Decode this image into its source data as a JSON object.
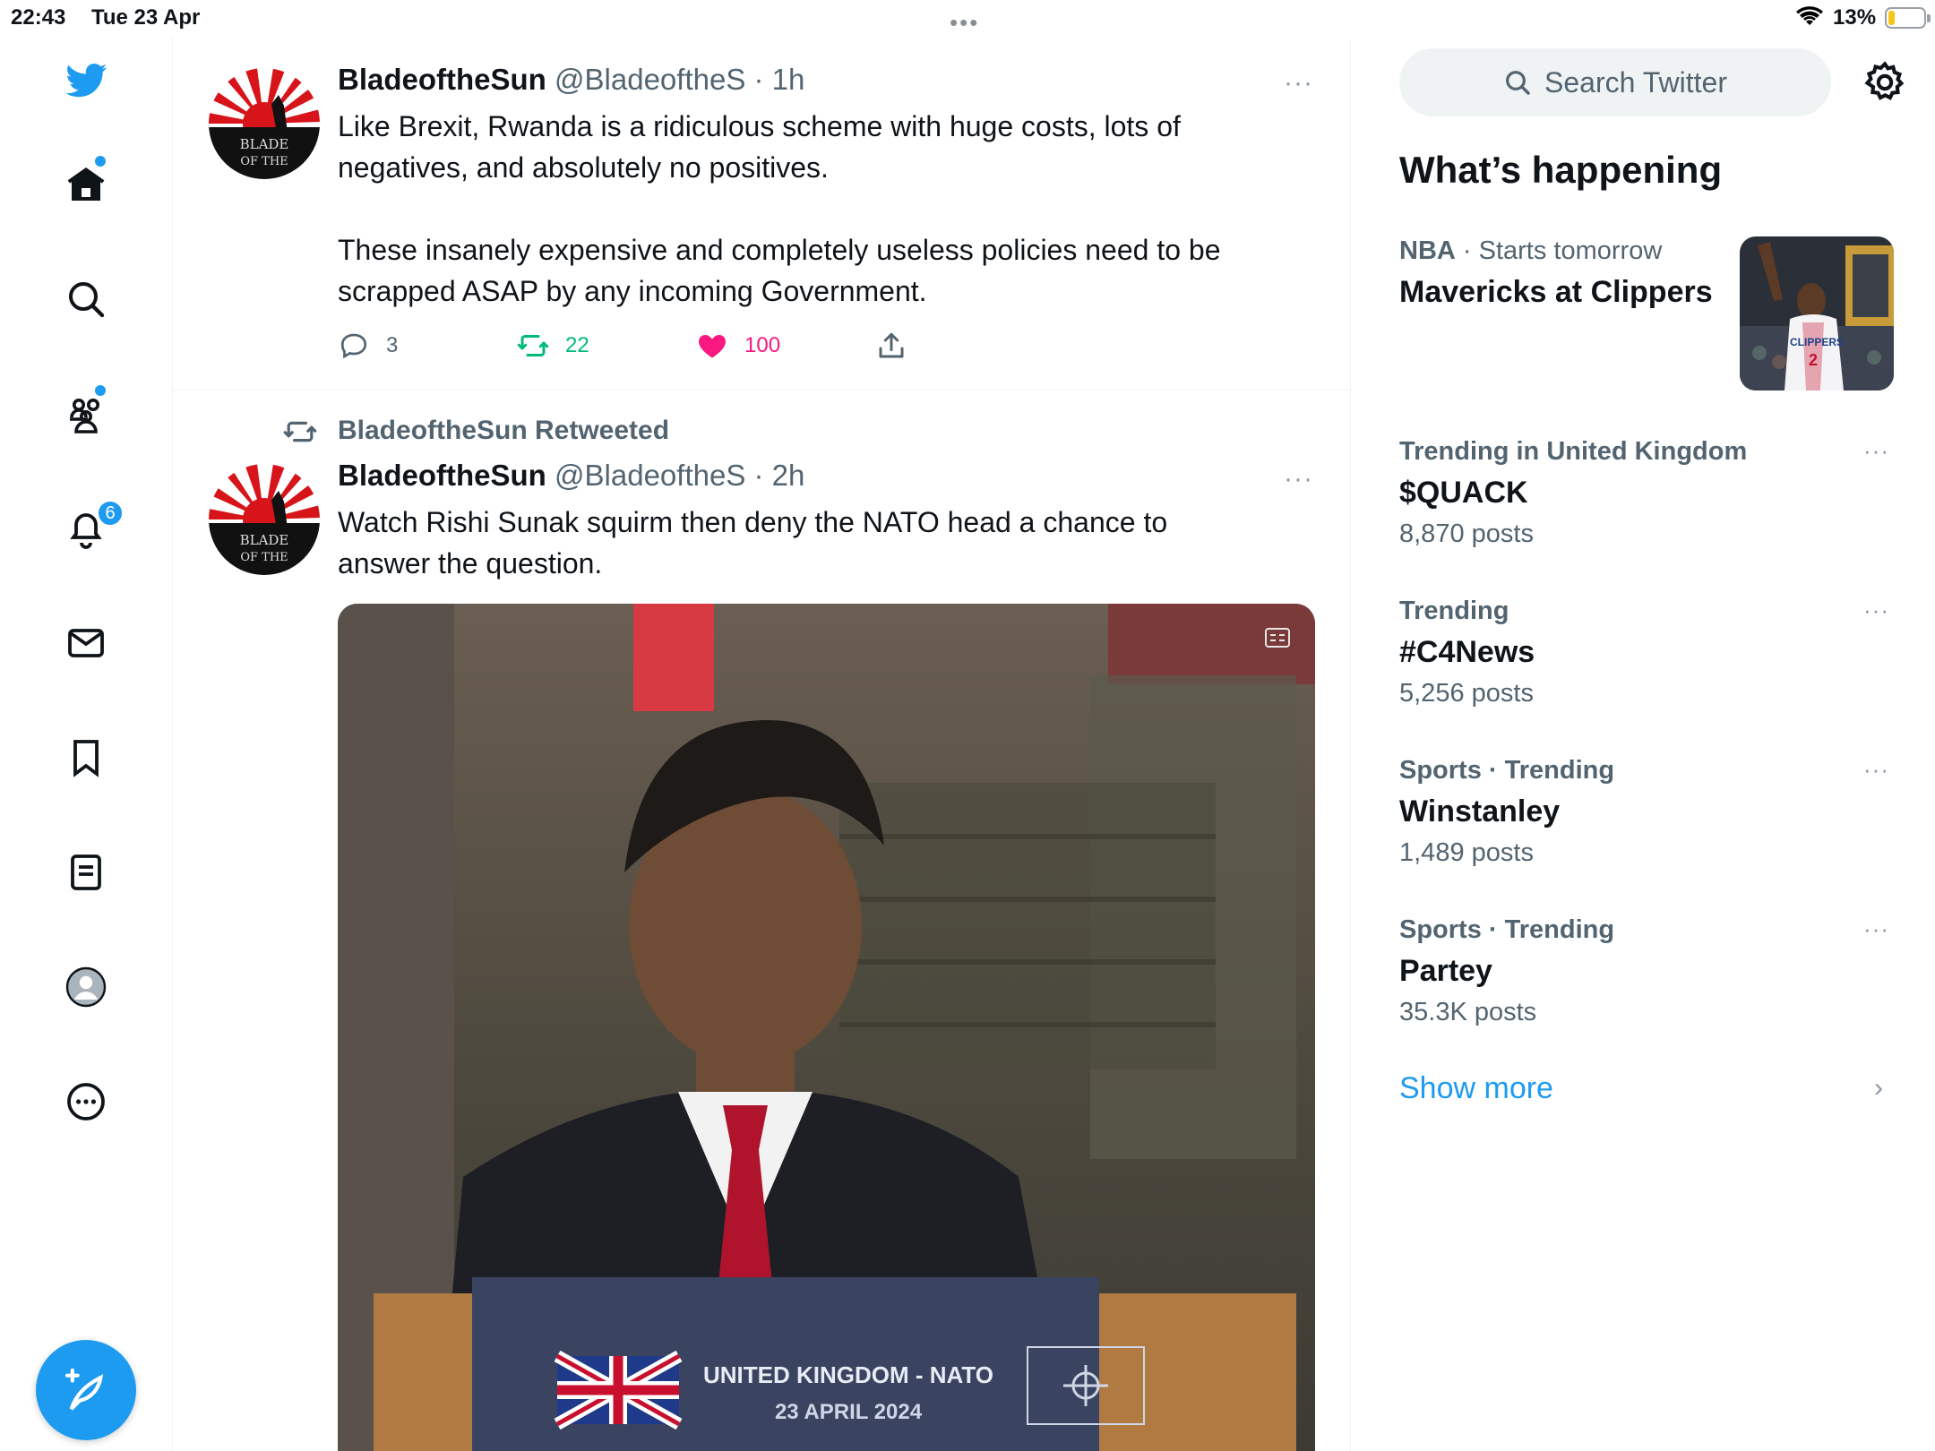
{
  "status_bar": {
    "time": "22:43",
    "date": "Tue 23 Apr",
    "battery": "13%",
    "battery_level": 0.13
  },
  "nav": {
    "notifications_badge": "6",
    "items": [
      "home-icon",
      "explore-icon",
      "communities-icon",
      "notifications-icon",
      "messages-icon",
      "bookmarks-icon",
      "lists-icon",
      "profile-icon",
      "more-icon"
    ]
  },
  "tweets": [
    {
      "name": "BladeoftheSun",
      "handle": "@BladeoftheS",
      "time": " · 1h",
      "more": "···",
      "text_line1": "Like Brexit, Rwanda is a ridiculous scheme with huge costs, lots of",
      "text_line2": "negatives, and absolutely no positives.",
      "text_line3": "These insanely expensive and completely useless policies need to be",
      "text_line4": "scrapped ASAP by any incoming Government.",
      "replies": "3",
      "retweets": "22",
      "likes": "100"
    },
    {
      "retweeted_by": "BladeoftheSun Retweeted",
      "name": "BladeoftheSun",
      "handle": "@BladeoftheS",
      "time": " · 2h",
      "more": "···",
      "text_line1": "Watch Rishi Sunak squirm then deny the NATO head a chance to",
      "text_line2": "answer the question.",
      "media": {
        "podium_line1": "UNITED KINGDOM - NATO",
        "podium_line2": "23 APRIL 2024"
      }
    }
  ],
  "sidebar": {
    "search_placeholder": "Search Twitter",
    "heading": "What’s happening",
    "trends": [
      {
        "meta_category": "NBA",
        "meta_rest": " · Starts tomorrow",
        "title": "Mavericks at Clippers",
        "count": ""
      },
      {
        "meta_category": "Trending in United Kingdom",
        "meta_rest": "",
        "title": "$QUACK",
        "count": "8,870 posts"
      },
      {
        "meta_category": "Trending",
        "meta_rest": "",
        "title": "#C4News",
        "count": "5,256 posts"
      },
      {
        "meta_category": "Sports · Trending",
        "meta_rest": "",
        "title": "Winstanley",
        "count": "1,489 posts"
      },
      {
        "meta_category": "Sports · Trending",
        "meta_rest": "",
        "title": "Partey",
        "count": "35.3K posts"
      }
    ],
    "more_dots": "···",
    "show_more": "Show more",
    "chevron": "›"
  },
  "colors": {
    "accent": "#1d9bf0",
    "retweet_green": "#00ba7c",
    "like_pink": "#f91880",
    "secondary_text": "#536471"
  }
}
